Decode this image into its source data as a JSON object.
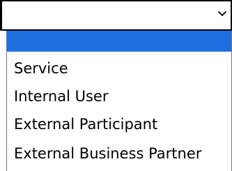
{
  "select": {
    "value": "",
    "chevron_icon": "chevron-down-icon"
  },
  "dropdown": {
    "options": [
      {
        "label": "",
        "highlighted": true
      },
      {
        "label": "Service"
      },
      {
        "label": "Internal User"
      },
      {
        "label": "External Participant"
      },
      {
        "label": "External Business Partner"
      }
    ]
  },
  "colors": {
    "highlight": "#1e6fe0",
    "border": "#000000",
    "list_border": "#767676"
  }
}
